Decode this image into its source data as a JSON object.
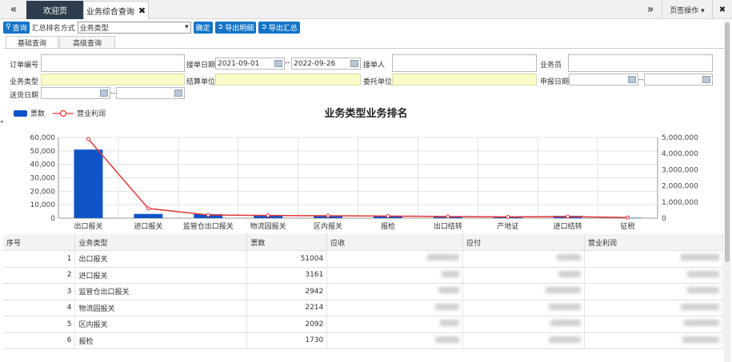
{
  "tabs": {
    "back_icon": "«",
    "welcome": "欢迎页",
    "active": "业务综合查询",
    "close": "✖",
    "forward_icon": "»",
    "page_ops": "页签操作 ▾",
    "fullscreen_icon": "✖"
  },
  "toolbar": {
    "query": "查询",
    "summary_label": "汇总排名方式",
    "summary_value": "业务类型",
    "confirm": "确定",
    "export_detail": "导出明细",
    "export_summary": "导出汇总"
  },
  "subtabs": {
    "basic": "基础查询",
    "advanced": "高级查询"
  },
  "form": {
    "order_no": "订单编号",
    "receive_date": "接单日期",
    "date_from": "2021-09-01",
    "date_sep": "--",
    "date_to": "2022-09-26",
    "receiver": "接单人",
    "salesman": "业务员",
    "biz_type": "业务类型",
    "settle_unit": "结算单位",
    "client_unit": "委托单位",
    "declare_date": "申报日期",
    "delivery_date": "送货日期"
  },
  "legend": {
    "bar": "票数",
    "line": "营业利润"
  },
  "chart_data": {
    "type": "bar",
    "title": "业务类型业务排名",
    "categories": [
      "出口报关",
      "进口报关",
      "监管仓出口报关",
      "物流园报关",
      "区内报关",
      "报检",
      "出口结转",
      "产地证",
      "进口结转",
      "征税"
    ],
    "series": [
      {
        "name": "票数",
        "type": "bar",
        "axis": "left",
        "values": [
          51004,
          3161,
          2942,
          2214,
          2092,
          1730,
          1100,
          1000,
          1700,
          300
        ]
      },
      {
        "name": "营业利润",
        "type": "line",
        "axis": "right",
        "values": [
          4900000,
          600000,
          200000,
          170000,
          150000,
          130000,
          100000,
          80000,
          100000,
          40000
        ]
      }
    ],
    "ylim_left": [
      0,
      60000
    ],
    "yticks_left": [
      "0",
      "10,000",
      "20,000",
      "30,000",
      "40,000",
      "50,000",
      "60,000"
    ],
    "ylim_right": [
      0,
      5000000
    ],
    "yticks_right": [
      "0",
      "1,000,000",
      "2,000,000",
      "3,000,000",
      "4,000,000",
      "5,000,000"
    ],
    "colors": {
      "bar": "#1054c8",
      "line": "#e53535"
    },
    "grid": true,
    "legend": "top-left"
  },
  "table": {
    "headers": [
      "序号",
      "业务类型",
      "票数",
      "应收",
      "应付",
      "营业利润"
    ],
    "rows": [
      [
        "1",
        "出口报关",
        "51004"
      ],
      [
        "2",
        "进口报关",
        "3161"
      ],
      [
        "3",
        "监管仓出口报关",
        "2942"
      ],
      [
        "4",
        "物流园报关",
        "2214"
      ],
      [
        "5",
        "区内报关",
        "2092"
      ],
      [
        "6",
        "报检",
        "1730"
      ]
    ]
  }
}
